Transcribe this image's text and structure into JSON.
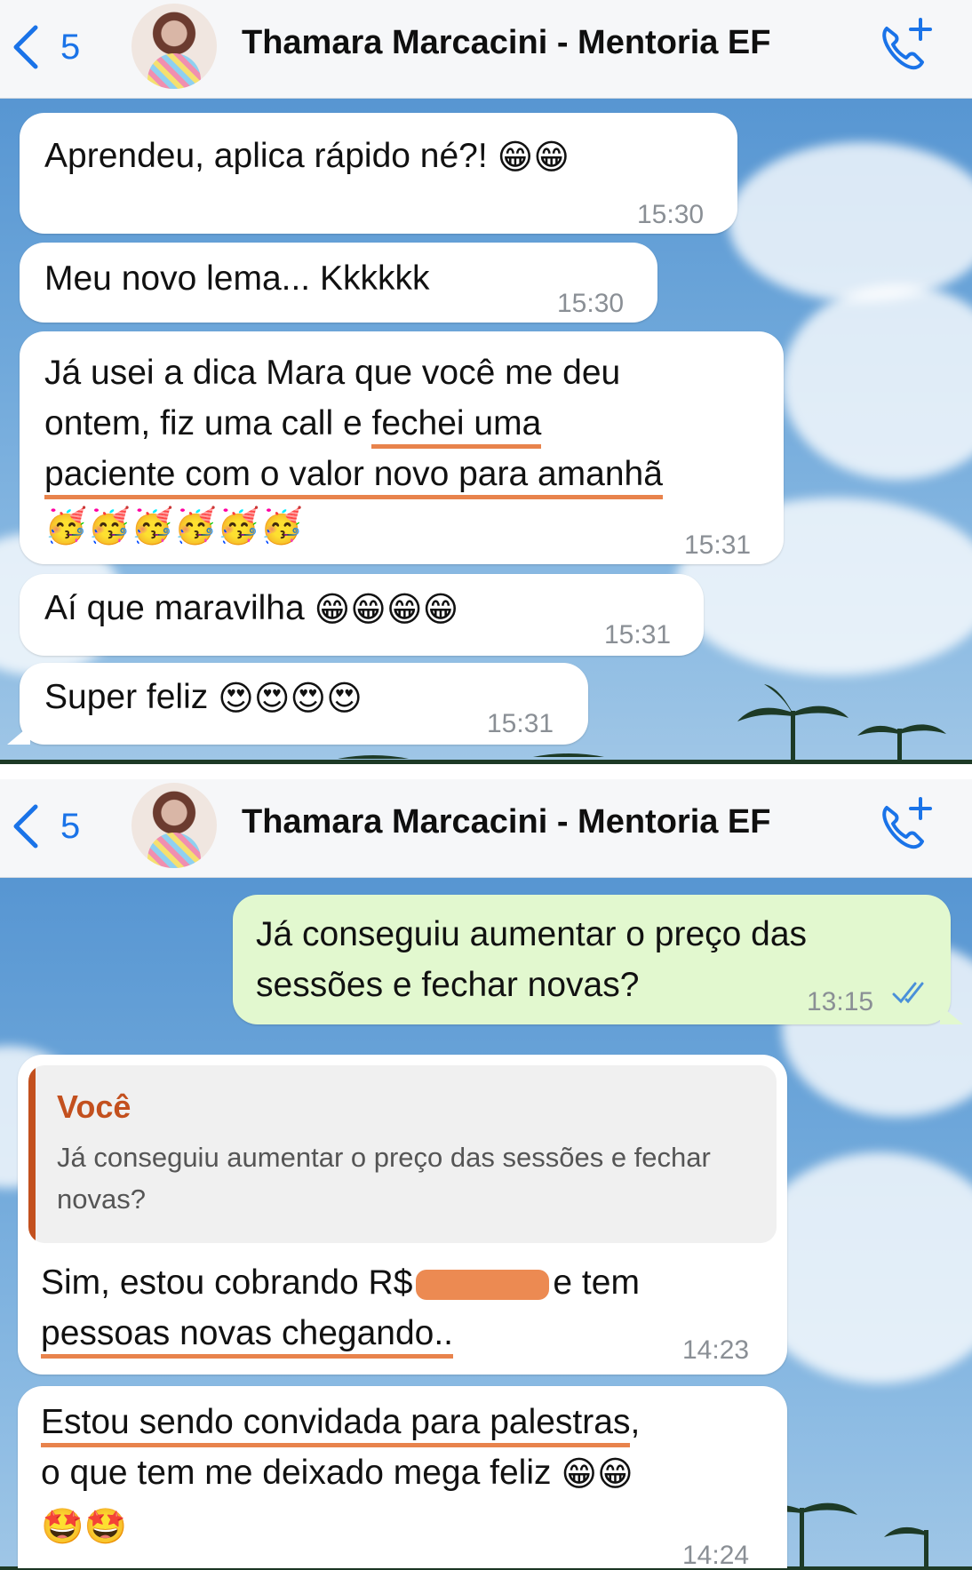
{
  "header": {
    "back_count": "5",
    "title": "Thamara Marcacini - Mentoria EF"
  },
  "colors": {
    "accent": "#1a73e8",
    "underline": "#e8834c",
    "quote": "#c3501e",
    "outgoing": "#e2f8cf"
  },
  "chat1": [
    {
      "text": "Aprendeu, aplica rápido né?! ",
      "emoji": "😁😁",
      "time": "15:30"
    },
    {
      "text": "Meu novo lema... Kkkkkk",
      "time": "15:30"
    },
    {
      "line1": "Já usei a dica Mara que você me deu",
      "line2_a": "ontem, fiz uma call e ",
      "line2_b": "fechei uma",
      "line3": "paciente com o valor novo para amanhã",
      "emoji": "🥳🥳🥳🥳🥳🥳",
      "time": "15:31"
    },
    {
      "text": "Aí que maravilha ",
      "emoji": "😁😁😁😁",
      "time": "15:31"
    },
    {
      "text": "Super feliz ",
      "emoji": "😍😍😍😍",
      "time": "15:31"
    }
  ],
  "chat2": {
    "outgoing": {
      "line1": "Já conseguiu aumentar o preço das",
      "line2": "sessões e fechar novas?",
      "time": "13:15",
      "status_icon": "double-check-icon"
    },
    "reply": {
      "quote_name": "Você",
      "quote_text": "Já conseguiu aumentar o preço das sessões e fechar novas?",
      "line1_a": "Sim, estou cobrando R$",
      "line1_b": "e tem",
      "line2": "pessoas novas chegando..",
      "time": "14:23"
    },
    "last": {
      "line1": "Estou sendo convidada para palestras",
      "line1_comma": ",",
      "line2": "o que tem me deixado mega feliz ",
      "emoji2": "😁😁",
      "emoji3": "🤩🤩",
      "time": "14:24"
    }
  }
}
